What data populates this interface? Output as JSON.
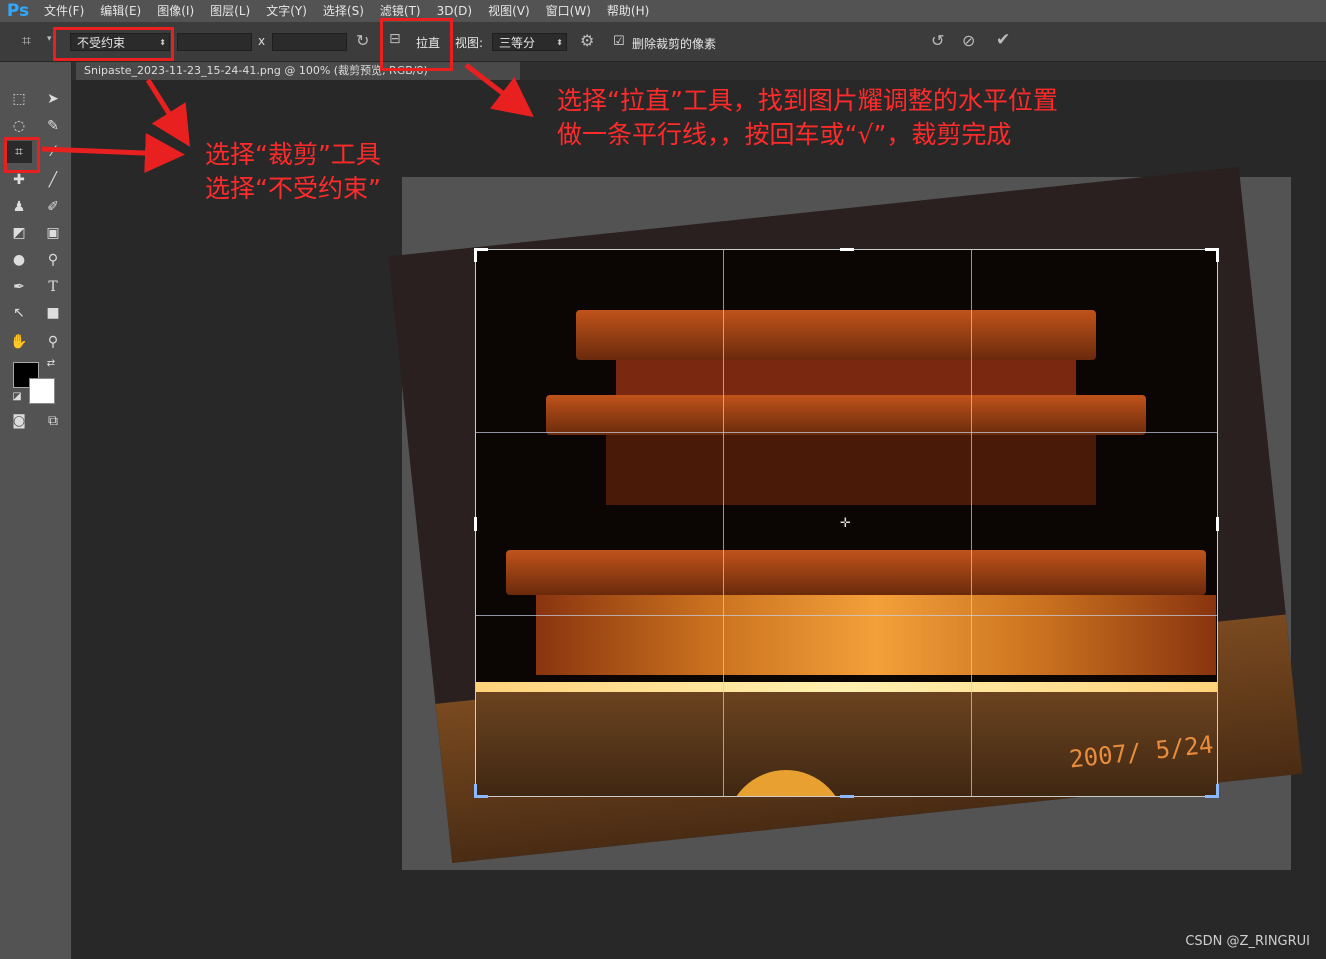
{
  "app": {
    "logo": "Ps"
  },
  "menu": [
    "文件(F)",
    "编辑(E)",
    "图像(I)",
    "图层(L)",
    "文字(Y)",
    "选择(S)",
    "滤镜(T)",
    "3D(D)",
    "视图(V)",
    "窗口(W)",
    "帮助(H)"
  ],
  "options": {
    "ratio_select": "不受约束",
    "width_value": "",
    "height_value": "",
    "x_sep": "x",
    "straighten_label": "拉直",
    "view_label": "视图:",
    "view_select": "三等分",
    "delete_cropped_label": "删除裁剪的像素",
    "delete_cropped_checked": true
  },
  "document": {
    "tab_title": "Snipaste_2023-11-23_15-24-41.png @ 100% (裁剪预览, RGB/8)"
  },
  "photo": {
    "date_stamp": "2007/ 5/24"
  },
  "annotations": {
    "crop_tool_line1": "选择“裁剪”工具",
    "crop_tool_line2": "选择“不受约束”",
    "straighten_line1": "选择“拉直”工具，找到图片耀调整的水平位置",
    "straighten_line2": "做一条平行线，，按回车或“√”，裁剪完成"
  },
  "watermark": "CSDN @Z_RINGRUI",
  "colors": {
    "annotation": "#ff2b2b",
    "ps_blue": "#31a8ff"
  }
}
